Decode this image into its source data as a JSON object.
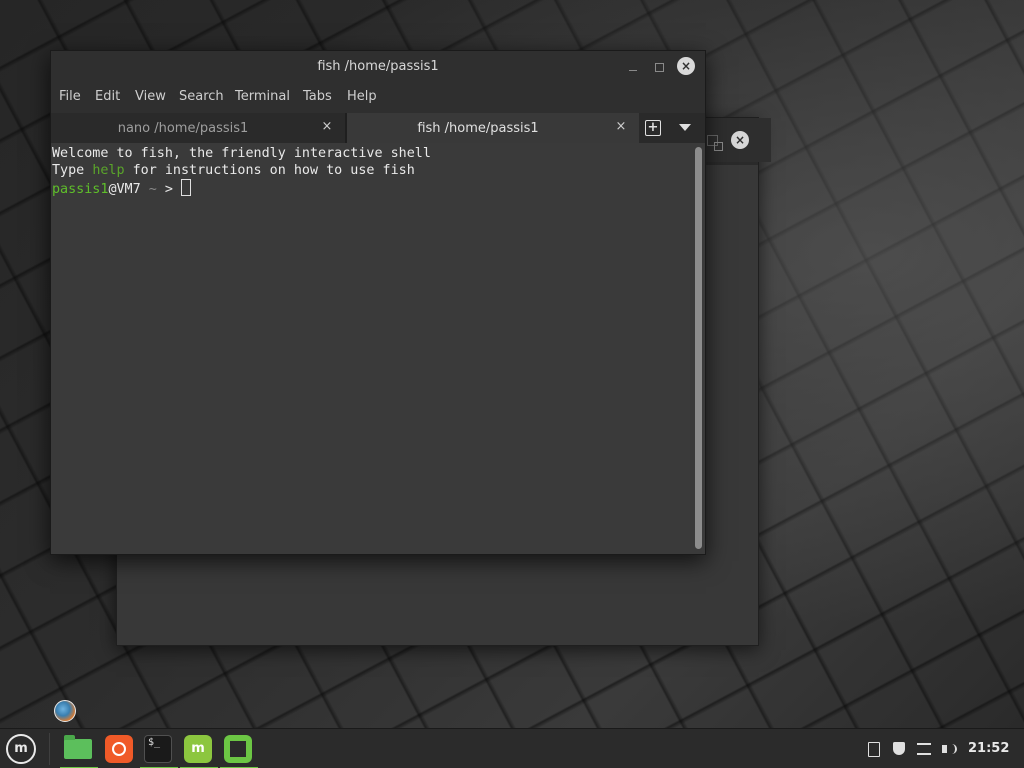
{
  "window": {
    "title": "fish /home/passis1",
    "minimize_label": "",
    "maximize_label": "",
    "close_label": "×"
  },
  "menu": {
    "items": [
      "File",
      "Edit",
      "View",
      "Search",
      "Terminal",
      "Tabs",
      "Help"
    ]
  },
  "tabs": [
    {
      "label": "nano /home/passis1",
      "active": false,
      "close": "×"
    },
    {
      "label": "fish /home/passis1",
      "active": true,
      "close": "×"
    }
  ],
  "tab_controls": {
    "new_tab": "+"
  },
  "terminal": {
    "line1": "Welcome to fish, the friendly interactive shell",
    "line2_prefix": "Type ",
    "line2_keyword": "help",
    "line2_suffix": " for instructions on how to use fish",
    "prompt_user": "passis1",
    "prompt_host": "@VM7",
    "prompt_path": " ~",
    "prompt_symbol": ">"
  },
  "taskbar": {
    "menu_label": "m",
    "terminal_glyph": "$_",
    "mint_glyph": "m",
    "clock": "21:52"
  },
  "back_window": {
    "close_label": "×"
  },
  "colors": {
    "accent_green": "#6cc644",
    "help_keyword": "#5aa52a",
    "prompt_user": "#5fbf2a"
  },
  "icons": {
    "taskbar": [
      "mint-menu-icon",
      "folder-icon",
      "firefox-icon",
      "terminal-icon",
      "mint-update-icon",
      "window-icon"
    ],
    "tray": [
      "clipboard-icon",
      "shield-icon",
      "network-icon",
      "volume-icon"
    ]
  }
}
